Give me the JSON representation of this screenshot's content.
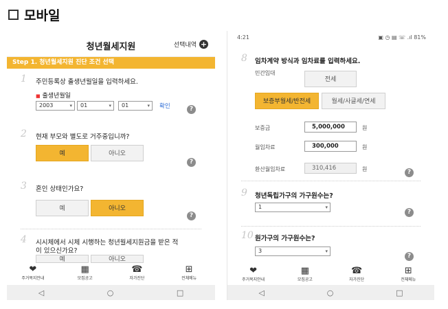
{
  "page": {
    "title": "모바일"
  },
  "left": {
    "app_title": "청년월세지원",
    "history_label": "선택내역",
    "step_label": "Step 1. 청년월세지원 진단 조건 선택",
    "q1": {
      "num": "1",
      "text": "주민등록상 출생년월일을 입력하세요.",
      "field_label": "출생년월일",
      "year": "2003",
      "month": "01",
      "day": "01",
      "confirm": "확인"
    },
    "q2": {
      "num": "2",
      "text": "현재 부모와 별도로 거주중입니까?",
      "yes": "예",
      "no": "아니오",
      "selected": "yes"
    },
    "q3": {
      "num": "3",
      "text": "혼인 상태인가요?",
      "yes": "예",
      "no": "아니오",
      "selected": "no"
    },
    "q4": {
      "num": "4",
      "text_line1": "시시체에서 시체 시행하는 청년월세지원금을 받은 적",
      "text_line2": "이 있으신가요?",
      "yes": "예",
      "no": "아니오"
    },
    "nav": [
      {
        "icon": "heart-hand-icon",
        "label": "주거복지안내"
      },
      {
        "icon": "calendar-icon",
        "label": "모집공고"
      },
      {
        "icon": "self-check-icon",
        "label": "자가진단"
      },
      {
        "icon": "menu-icon",
        "label": "전체메뉴"
      }
    ]
  },
  "right": {
    "status_time": "4:21",
    "status_icons": "▣ ◷ ▤ ☏ .ıl 81%",
    "q8": {
      "num": "8",
      "text": "임차계약 방식과 임차료를 입력하세요.",
      "private_label": "민간임대",
      "opt_jeonse": "전세",
      "opt_deposit_monthly": "보증부월세/반전세",
      "opt_monthly": "월세/사글세/연세",
      "deposit_label": "보증금",
      "deposit_value": "5,000,000",
      "monthly_label": "월임차료",
      "monthly_value": "300,000",
      "converted_label": "환산월임차료",
      "converted_value": "310,416",
      "unit": "원"
    },
    "q9": {
      "num": "9",
      "text": "청년독립가구의 가구원수는?",
      "value": "1"
    },
    "q10": {
      "num": "10",
      "text": "원가구의 가구원수는?",
      "value": "3"
    },
    "nav": [
      {
        "icon": "heart-hand-icon",
        "label": "주거복지안내"
      },
      {
        "icon": "calendar-icon",
        "label": "모집공고"
      },
      {
        "icon": "self-check-icon",
        "label": "자가진단"
      },
      {
        "icon": "menu-icon",
        "label": "전체메뉴"
      }
    ]
  },
  "sys_nav": {
    "back": "◁",
    "home": "○",
    "recent": "□"
  },
  "help_glyph": "?",
  "accent": "#f3b531"
}
